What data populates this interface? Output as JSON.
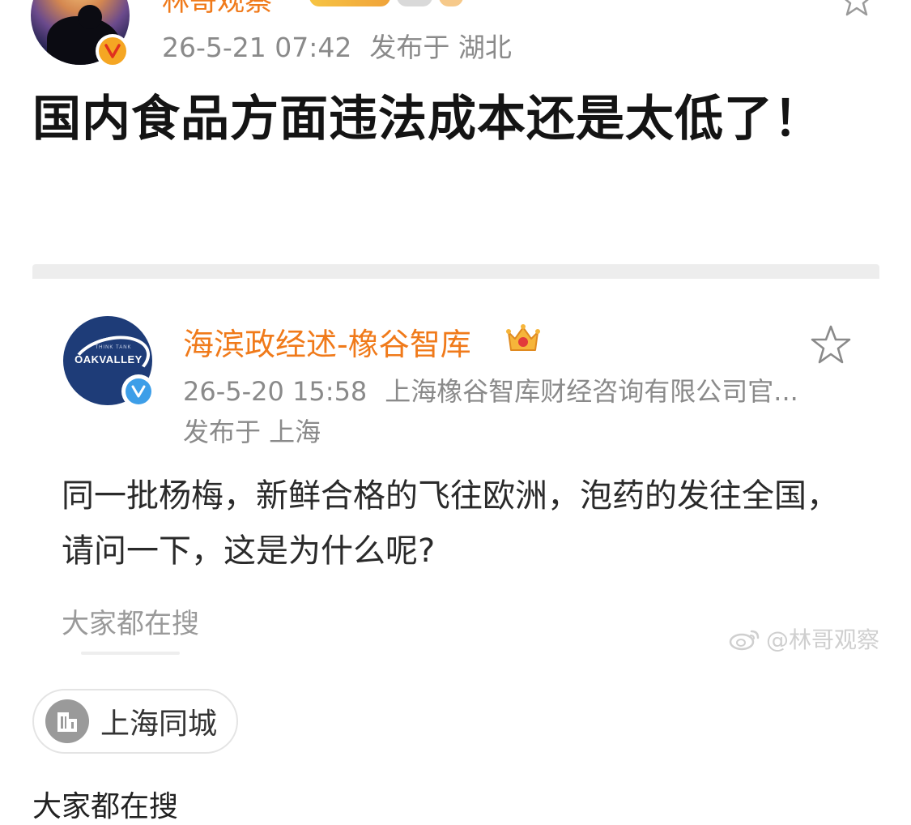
{
  "post": {
    "author": "林哥观察",
    "timestamp": "26-5-21 07:42",
    "location": "发布于 湖北",
    "text": "国内食品方面违法成本还是太低了！",
    "verified_icon": "orange-verified-badge-icon",
    "colors": {
      "author": "#f07a1a",
      "verified": "#f5a623"
    }
  },
  "repost": {
    "author": "海滨政经述-橡谷智库",
    "avatar_brand_small": "THINK TANK",
    "avatar_brand": "OAKVALLEY",
    "timestamp": "26-5-20 15:58",
    "source": "上海橡谷智库财经咨询有限公司官...",
    "location": "发布于 上海",
    "text": "同一批杨梅，新鲜合格的飞往欧洲，泡药的发往全国，请问一下，这是为什么呢?",
    "search_hint": "大家都在搜",
    "watermark": "@林哥观察",
    "verified_icon": "blue-verified-badge-icon",
    "colors": {
      "author": "#f07a1a",
      "verified": "#3d9ee8"
    }
  },
  "location_chip": {
    "label": "上海同城",
    "icon": "building-icon"
  },
  "bottom_partial_text": "大家都在搜"
}
